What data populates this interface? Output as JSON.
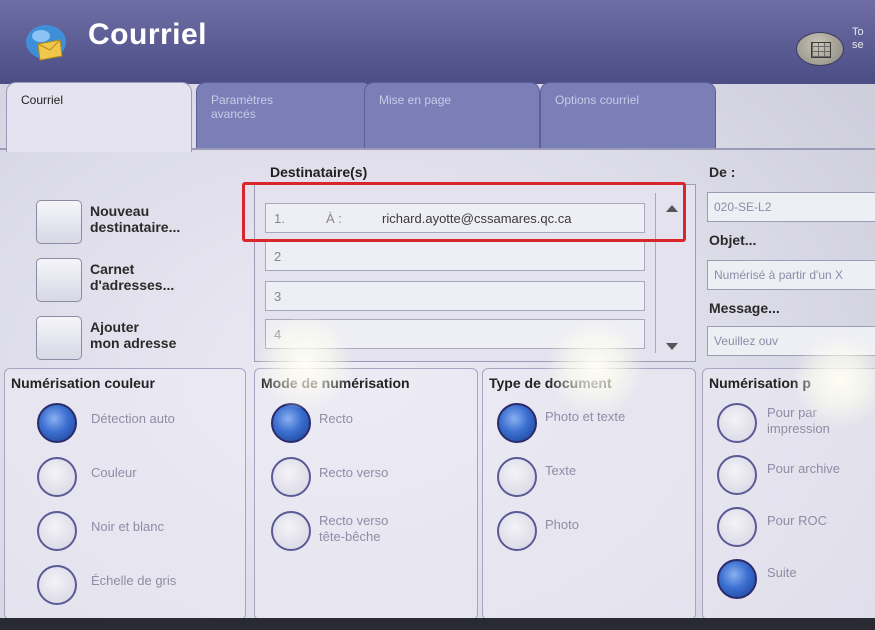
{
  "header": {
    "title": "Courriel",
    "cut_text": "To\nse"
  },
  "tabs": [
    {
      "label": "Courriel"
    },
    {
      "label": "Paramètres\navancés"
    },
    {
      "label": "Mise en page"
    },
    {
      "label": "Options courriel"
    }
  ],
  "left_buttons": [
    {
      "label": "Nouveau\ndestinataire..."
    },
    {
      "label": "Carnet\nd'adresses..."
    },
    {
      "label": "Ajouter\nmon adresse"
    }
  ],
  "recipients": {
    "title": "Destinataire(s)",
    "rows": [
      {
        "num": "1.",
        "prefix": "À :",
        "address": "richard.ayotte@cssamares.qc.ca"
      },
      {
        "num": "2",
        "prefix": "",
        "address": ""
      },
      {
        "num": "3",
        "prefix": "",
        "address": ""
      },
      {
        "num": "4",
        "prefix": "",
        "address": ""
      }
    ]
  },
  "right_panel": {
    "from_label": "De :",
    "from_value": "020-SE-L2",
    "subject_label": "Objet...",
    "subject_value": "Numérisé à partir d'un X",
    "message_label": "Message...",
    "message_value": "Veuillez ouv"
  },
  "groups": {
    "color": {
      "title": "Numérisation couleur",
      "options": [
        {
          "label": "Détection auto",
          "selected": true
        },
        {
          "label": "Couleur",
          "selected": false
        },
        {
          "label": "Noir et blanc",
          "selected": false
        },
        {
          "label": "Échelle de gris",
          "selected": false
        }
      ]
    },
    "sides": {
      "title": "Mode de numérisation",
      "options": [
        {
          "label": "Recto",
          "selected": true
        },
        {
          "label": "Recto verso",
          "selected": false
        },
        {
          "label": "Recto verso\ntête-bêche",
          "selected": false
        }
      ]
    },
    "doctype": {
      "title": "Type de document",
      "options": [
        {
          "label": "Photo et texte",
          "selected": true
        },
        {
          "label": "Texte",
          "selected": false
        },
        {
          "label": "Photo",
          "selected": false
        }
      ]
    },
    "preset": {
      "title": "Numérisation p",
      "options": [
        {
          "label": "Pour par\nimpression",
          "selected": false
        },
        {
          "label": "Pour archive",
          "selected": false
        },
        {
          "label": "Pour ROC",
          "selected": false
        },
        {
          "label": "Suite",
          "selected": true
        }
      ]
    }
  },
  "colors": {
    "header": "#5a5a92",
    "selected_radio": "#3b6fd0",
    "highlight": "#d8262b"
  },
  "icons": [
    "email-app-icon",
    "keypad-icon",
    "scroll-up-icon",
    "scroll-down-icon"
  ]
}
